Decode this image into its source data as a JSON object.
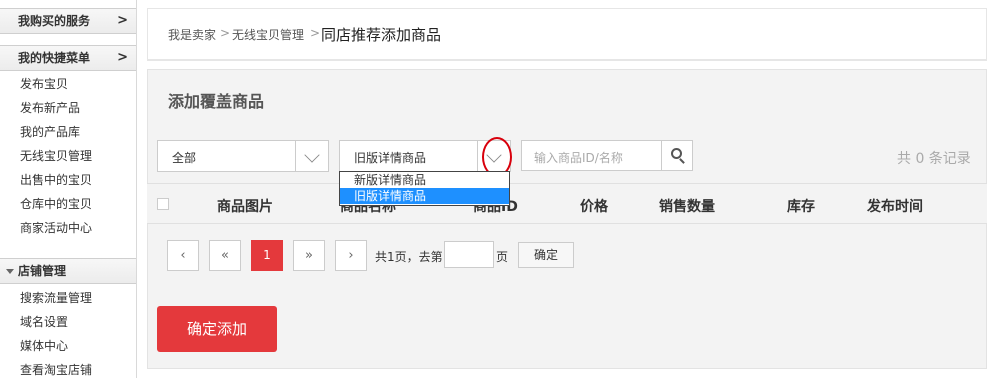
{
  "sidebar": {
    "section_service": {
      "title": "我购买的服务",
      "arrow": ">"
    },
    "section_shortcut": {
      "title": "我的快捷菜单",
      "arrow": ">"
    },
    "shortcut_items": [
      "发布宝贝",
      "发布新产品",
      "我的产品库",
      "无线宝贝管理",
      "出售中的宝贝",
      "仓库中的宝贝",
      "商家活动中心"
    ],
    "section_store": {
      "title": "店铺管理"
    },
    "store_items": [
      "搜索流量管理",
      "域名设置",
      "媒体中心",
      "查看淘宝店铺"
    ]
  },
  "breadcrumb": {
    "seller": "我是卖家",
    "wireless": "无线宝贝管理",
    "current": "同店推荐添加商品",
    "separator": ">"
  },
  "panel": {
    "title": "添加覆盖商品",
    "category_select": {
      "value": "全部"
    },
    "detail_select": {
      "value": "旧版详情商品",
      "options": [
        "新版详情商品",
        "旧版详情商品"
      ],
      "highlighted": "旧版详情商品"
    },
    "search": {
      "placeholder": "输入商品ID/名称"
    },
    "total": "共 0 条记录"
  },
  "table": {
    "headers": [
      "商品图片",
      "商品名称",
      "商品ID",
      "价格",
      "销售数量",
      "库存",
      "发布时间"
    ]
  },
  "pagination": {
    "current_page": "1",
    "first": "«",
    "prev": "‹",
    "next": "›",
    "last": "»",
    "summary": "共1页，去第",
    "page_unit": "页",
    "go_label": "确定"
  },
  "confirm_button": "确定添加",
  "colors": {
    "accent": "#e4393c",
    "highlight": "#1e90ff",
    "annotation": "#d8000c"
  }
}
